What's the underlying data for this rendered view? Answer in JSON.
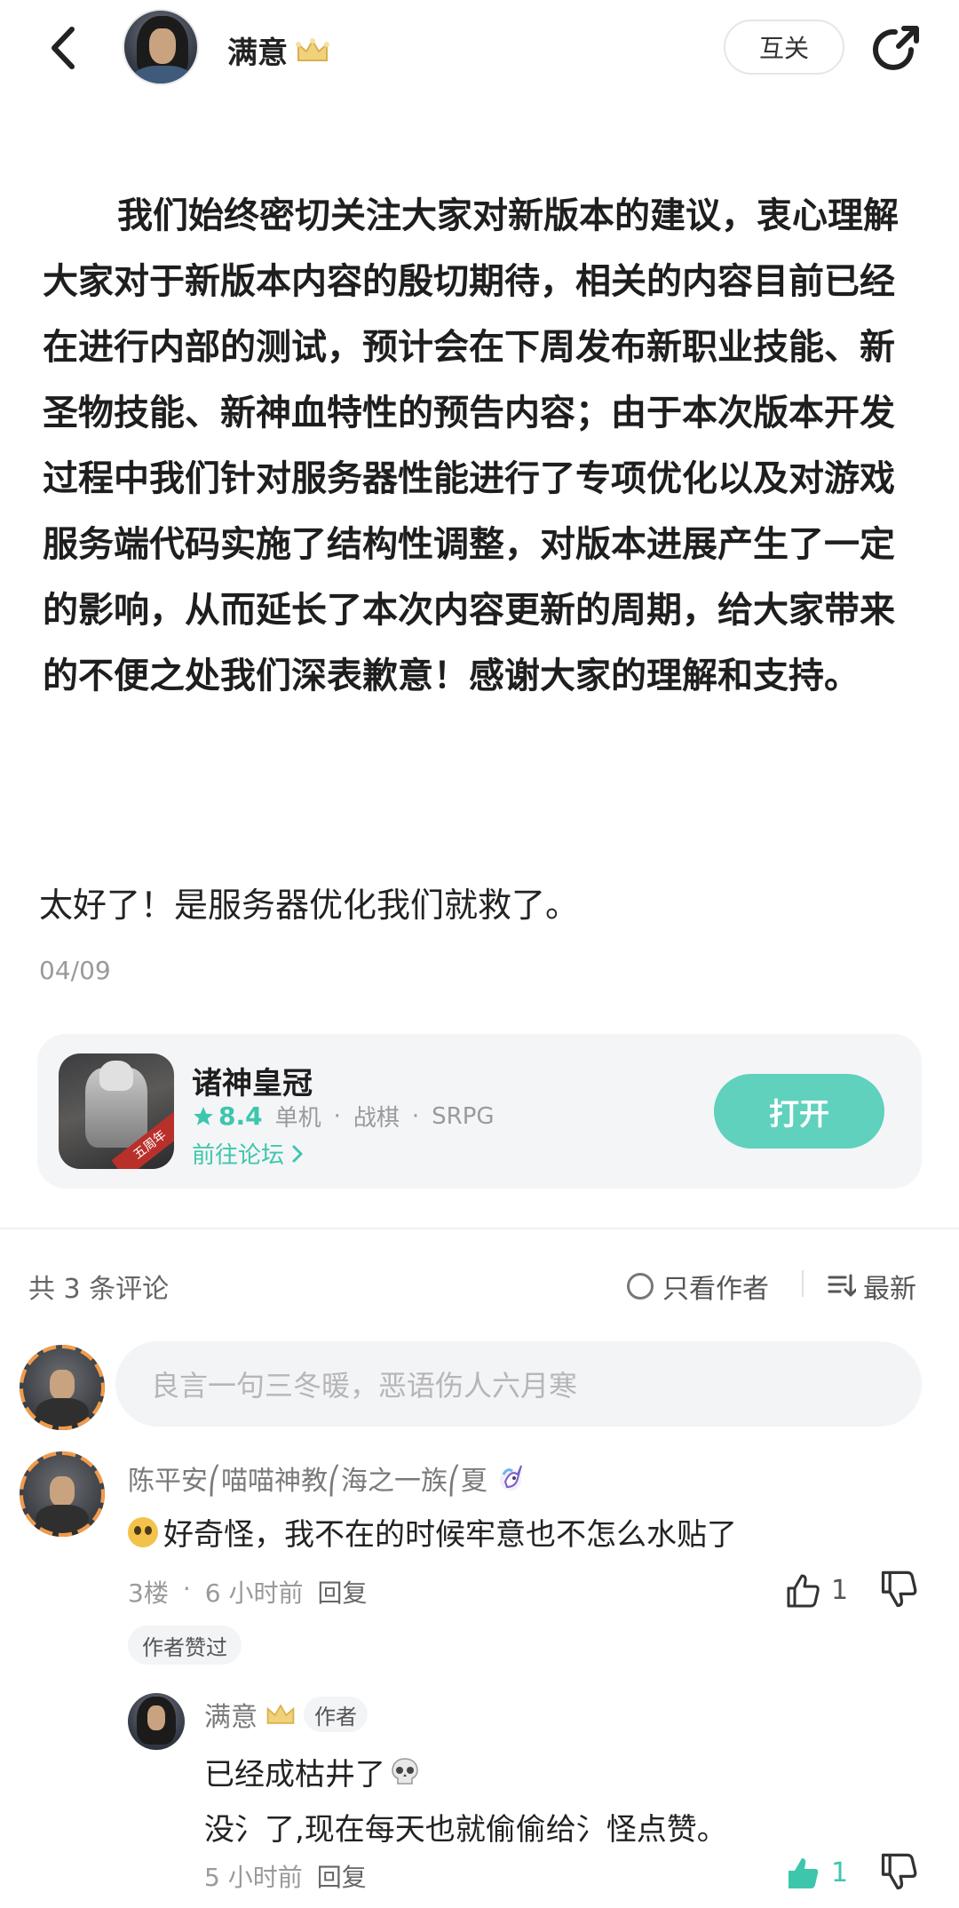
{
  "header": {
    "author_name": "满意",
    "mutual_label": "互关"
  },
  "post": {
    "paragraph": "我们始终密切关注大家对新版本的建议，衷心理解大家对于新版本内容的殷切期待，相关的内容目前已经在进行内部的测试，预计会在下周发布新职业技能、新圣物技能、新神血特性的预告内容；由于本次版本开发过程中我们针对服务器性能进行了专项优化以及对游戏服务端代码实施了结构性调整，对版本进展产生了一定的影响，从而延长了本次内容更新的周期，给大家带来的不便之处我们深表歉意！感谢大家的理解和支持。",
    "comment": "太好了！是服务器优化我们就救了。",
    "date": "04/09"
  },
  "game_card": {
    "icon_badge": "五周年",
    "title": "诸神皇冠",
    "rating": "8.4",
    "tags": [
      "单机",
      "战棋",
      "SRPG"
    ],
    "tag_sep": "·",
    "forum_link": "前往论坛",
    "open_label": "打开",
    "accent": "#5fd1bd"
  },
  "comments_bar": {
    "count_label": "共 3 条评论",
    "author_only_label": "只看作者",
    "sort_label": "最新"
  },
  "comment_input": {
    "placeholder": "良言一句三冬暖，恶语伤人六月寒"
  },
  "comment": {
    "user": "陈平安⎛喵喵神教⎛海之一族⎛夏",
    "text": "好奇怪，我不在的时候牢意也不怎么水贴了",
    "floor": "3楼",
    "dot": "·",
    "time": "6 小时前",
    "reply_label": "回复",
    "likes": "1",
    "author_liked": "作者赞过"
  },
  "reply": {
    "user": "满意",
    "author_tag": "作者",
    "line1": "已经成枯井了",
    "line2": "没氵了,现在每天也就偷偷给氵怪点赞。",
    "time": "5 小时前",
    "reply_label": "回复",
    "likes": "1"
  }
}
